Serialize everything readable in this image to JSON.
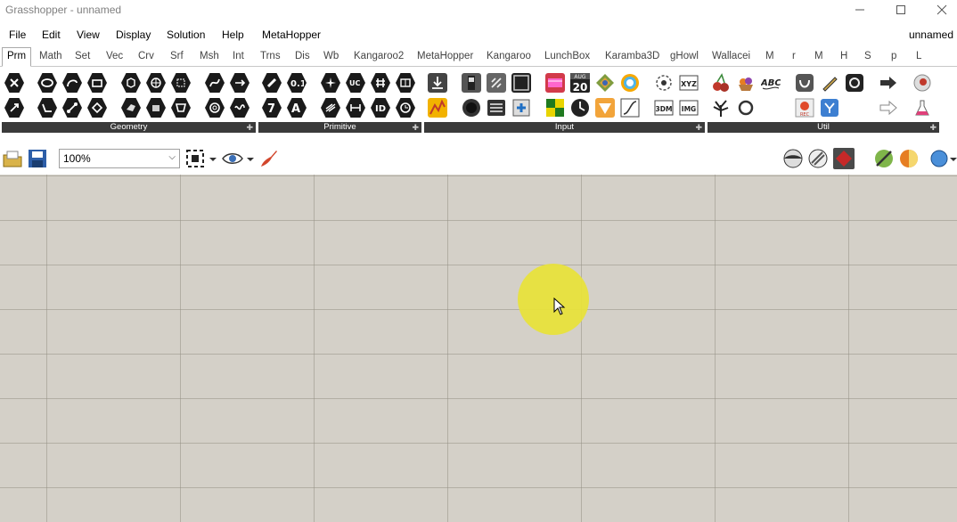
{
  "window": {
    "title": "Grasshopper - unnamed"
  },
  "menubar": {
    "items": [
      "File",
      "Edit",
      "View",
      "Display",
      "Solution",
      "Help",
      "MetaHopper"
    ],
    "document_name": "unnamed"
  },
  "tabs": [
    "Prm",
    "Math",
    "Set",
    "Vec",
    "Crv",
    "Srf",
    "Msh",
    "Int",
    "Trns",
    "Dis",
    "Wb",
    "Kangaroo2",
    "MetaHopper",
    "Kangaroo",
    "LunchBox",
    "Karamba3D",
    "gHowl",
    "Wallacei",
    "M",
    "r",
    "M",
    "H",
    "S",
    "p",
    "L"
  ],
  "active_tab": "Prm",
  "ribbon": {
    "groups": [
      "Geometry",
      "Primitive",
      "Input",
      "Util"
    ],
    "calendar_icon": {
      "month": "AUG",
      "day": "20"
    },
    "text_icons": [
      "XYZ",
      "3DM",
      "IMG",
      "ABC",
      "REC"
    ]
  },
  "toolbar": {
    "zoom_value": "100%"
  },
  "colors": {
    "canvas": "#d4d0c8",
    "grid": "#9a9488",
    "cursor_highlight": "#e8e23c",
    "group_label_bg": "#3a3a3a"
  }
}
